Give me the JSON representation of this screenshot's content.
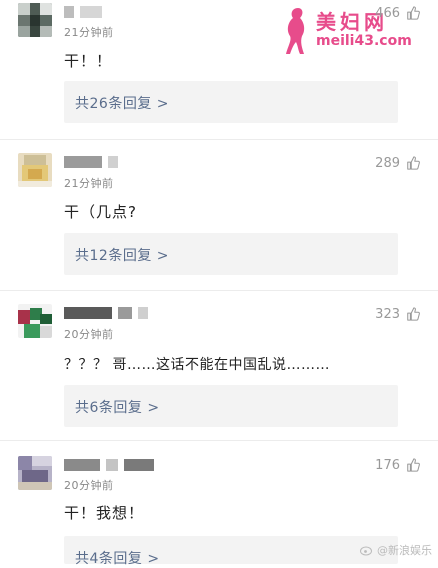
{
  "watermark": {
    "site_name": "美妇网",
    "site_url": "meili43.com",
    "weibo_handle": "@新浪娱乐"
  },
  "comments": [
    {
      "time": "21分钟前",
      "likes": "466",
      "text": "干！！",
      "reply_link": "共26条回复 >"
    },
    {
      "time": "21分钟前",
      "likes": "289",
      "text": "干（几点?",
      "reply_link": "共12条回复 >"
    },
    {
      "time": "20分钟前",
      "likes": "323",
      "text": "？？？ 哥……这话不能在中国乱说………",
      "reply_link": "共6条回复 >"
    },
    {
      "time": "20分钟前",
      "likes": "176",
      "text": "干！我想！",
      "reply_link": "共4条回复 >"
    }
  ],
  "colors": {
    "reply_link": "#5a6d8c",
    "reply_box_bg": "#f3f3f3",
    "time_text": "#888888",
    "watermark_pink": "#e74c8b"
  }
}
